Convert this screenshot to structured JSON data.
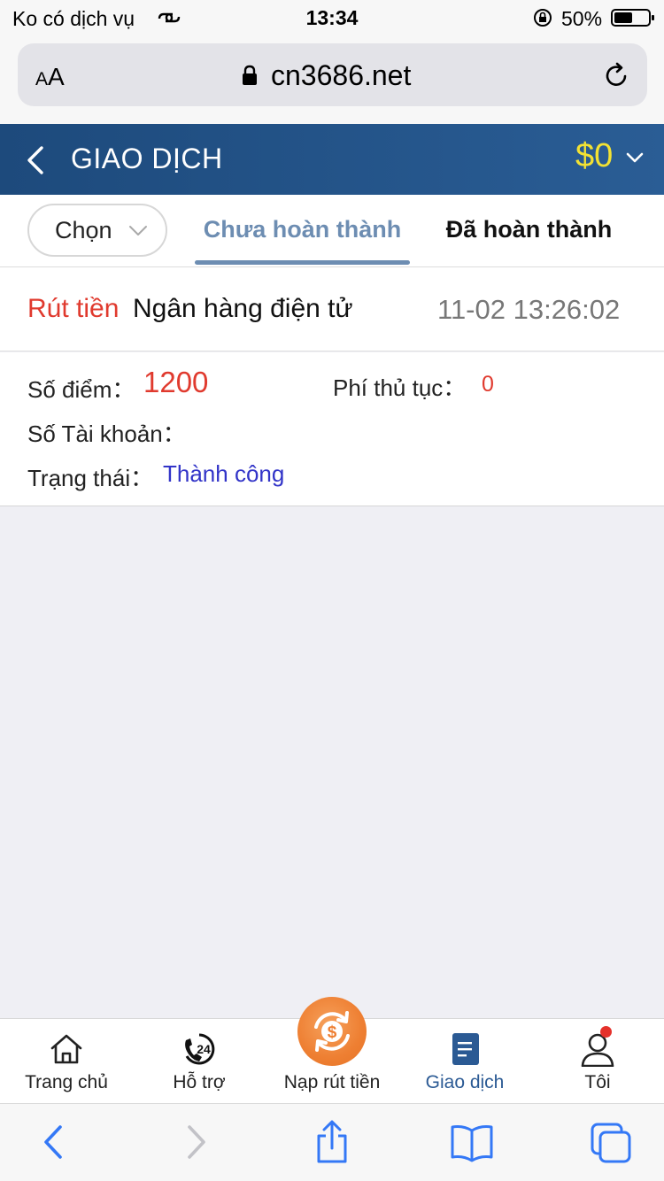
{
  "status_bar": {
    "carrier": "Ko có dịch vụ",
    "time": "13:34",
    "battery": "50%"
  },
  "browser": {
    "text_size": "AA",
    "url": "cn3686.net"
  },
  "header": {
    "title": "GIAO DỊCH",
    "balance": "$0"
  },
  "tabs": {
    "select_label": "Chọn",
    "pending": "Chưa hoàn thành",
    "completed": "Đã hoàn thành",
    "active": "pending"
  },
  "record": {
    "type": "Rút tiền",
    "method": "Ngân hàng điện tử",
    "time": "11-02 13:26:02",
    "points_label": "Số điểm：",
    "points_value": "1200",
    "fee_label": "Phí thủ tục：",
    "fee_value": "0",
    "account_label": "Số Tài khoản：",
    "status_label": "Trạng thái：",
    "status_value": "Thành công"
  },
  "tabbar": {
    "items": [
      {
        "label": "Trang chủ",
        "icon": "home-icon"
      },
      {
        "label": "Hỗ trợ",
        "icon": "support-24-icon"
      },
      {
        "label": "Nạp rút tiền",
        "icon": "dollar-exchange-icon"
      },
      {
        "label": "Giao dịch",
        "icon": "document-icon"
      },
      {
        "label": "Tôi",
        "icon": "user-icon"
      }
    ],
    "active_index": 3
  },
  "colors": {
    "header_bg": "#1d4a7c",
    "balance": "#f3e233",
    "accent_red": "#e03a2e",
    "tab_active": "#6d8db2",
    "status_success": "#3234c8",
    "fab": "#ee7f32",
    "ios_blue": "#3478f6"
  }
}
